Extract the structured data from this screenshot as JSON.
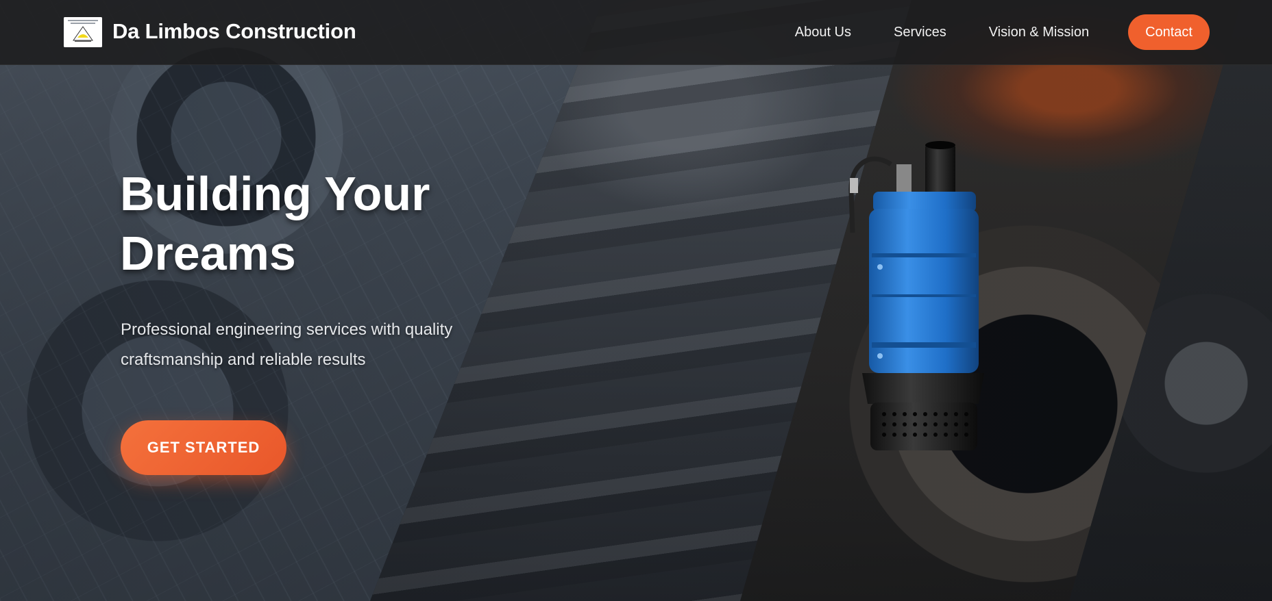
{
  "header": {
    "brand_name": "Da Limbos Construction",
    "logo_icon": "company-logo",
    "nav": [
      {
        "label": "About Us"
      },
      {
        "label": "Services"
      },
      {
        "label": "Vision & Mission"
      }
    ],
    "contact_label": "Contact"
  },
  "hero": {
    "title_line1": "Building Your",
    "title_line2": "Dreams",
    "subtitle_line1": "Professional engineering services with quality",
    "subtitle_line2": "craftsmanship and reliable results",
    "cta_label": "GET STARTED",
    "image_icon": "submersible-pump-image"
  },
  "colors": {
    "accent": "#f0602d",
    "header_bg": "#1c1c1e",
    "pump_blue": "#1f6fc8"
  }
}
